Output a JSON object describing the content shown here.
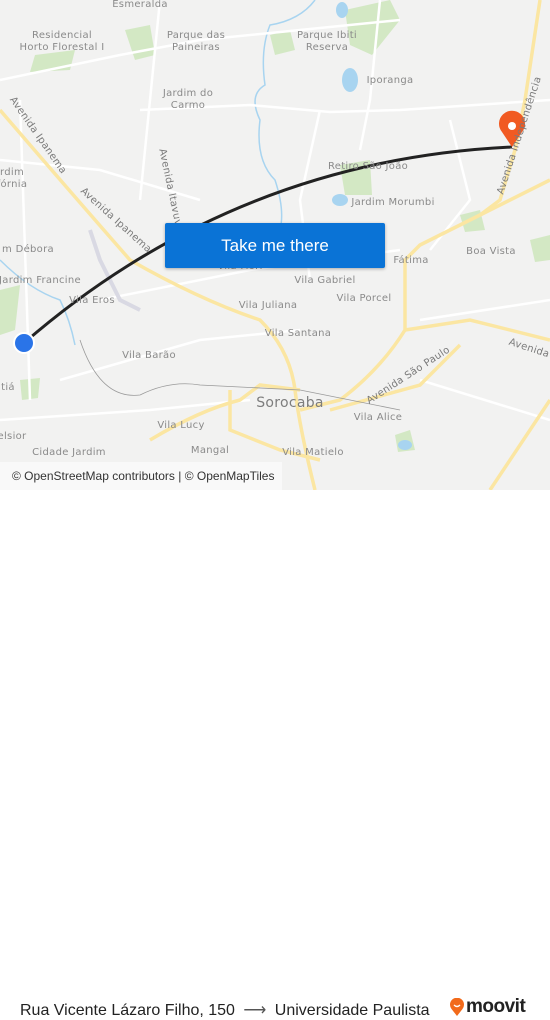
{
  "map": {
    "neighborhoods": [
      "Esmeralda",
      "Residencial\nHorto Florestal I",
      "Parque das\nPaineiras",
      "Parque Ibiti\nReserva",
      "Iporanga",
      "Jardim do\nCarmo",
      "rdim\nfórnia",
      "Retiro São João",
      "Jardim Morumbi",
      "m Débora",
      "Jardim Francine",
      "Vila Eros",
      "Vila Fiori",
      "Fátima",
      "Boa Vista",
      "Vila Gabriel",
      "Vila Porcel",
      "Vila Juliana",
      "Vila Santana",
      "Vila Barão",
      "tiá",
      "elsior",
      "Vila Lucy",
      "Vila Alice",
      "Cidade Jardim",
      "Vila Matielo",
      "Mangal"
    ],
    "city": "Sorocaba",
    "roads": [
      "Avenida Ipanema",
      "Avenida Ipanema",
      "Avenida Itavuvu",
      "Avenida Independência",
      "Avenida São Paulo",
      "Avenida"
    ],
    "colors": {
      "route": "#222222",
      "origin": "#2a74e8",
      "destination": "#f15a22",
      "road_major": "#fbe6a2",
      "park": "#cfe6bf",
      "water": "#a8d4f0"
    },
    "origin_icon": "origin-dot-icon",
    "destination_icon": "map-pin-icon"
  },
  "cta": {
    "label": "Take me there"
  },
  "attribution": "© OpenStreetMap contributors | © OpenMapTiles",
  "footer": {
    "origin": "Rua Vicente Lázaro Filho, 150",
    "arrow": "⟶",
    "destination": "Universidade Paulista",
    "brand": "moovit"
  }
}
